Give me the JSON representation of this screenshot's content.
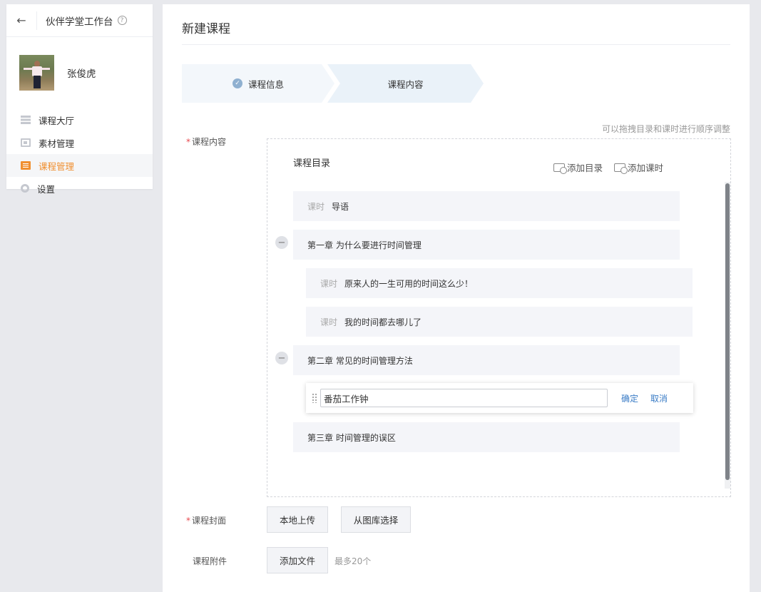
{
  "sidebar": {
    "back_icon": "arrow-left-icon",
    "title": "伙伴学堂工作台",
    "help_icon": "question-circle-icon",
    "user_name": "张俊虎",
    "items": [
      {
        "label": "课程大厅",
        "icon": "list-icon"
      },
      {
        "label": "素材管理",
        "icon": "media-icon"
      },
      {
        "label": "课程管理",
        "icon": "course-icon",
        "active": true
      },
      {
        "label": "设置",
        "icon": "gear-icon"
      }
    ],
    "active_color": "#f08f30"
  },
  "main": {
    "page_title": "新建课程",
    "steps": [
      {
        "label": "课程信息",
        "done": true
      },
      {
        "label": "课程内容",
        "done": false
      }
    ],
    "hint": "可以拖拽目录和课时进行顺序调整",
    "content_label": "课程内容",
    "catalog": {
      "title": "课程目录",
      "add_dir_label": "添加目录",
      "add_lesson_label": "添加课时",
      "lesson_tag": "课时",
      "rows": [
        {
          "type": "lesson",
          "text": "导语"
        },
        {
          "type": "chapter",
          "text": "第一章 为什么要进行时间管理"
        },
        {
          "type": "lesson",
          "text": "原来人的一生可用的时间这么少！"
        },
        {
          "type": "lesson",
          "text": "我的时间都去哪儿了"
        },
        {
          "type": "chapter",
          "text": "第二章 常见的时间管理方法"
        },
        {
          "type": "chapter",
          "text": "第三章 时间管理的误区"
        }
      ],
      "edit": {
        "value": "番茄工作钟",
        "confirm_label": "确定",
        "cancel_label": "取消"
      }
    },
    "cover_label": "课程封面",
    "cover_buttons": {
      "local": "本地上传",
      "library": "从图库选择"
    },
    "attach_label": "课程附件",
    "attach_button": "添加文件",
    "attach_note": "最多20个",
    "link_color": "#3a7cc6",
    "required_color": "#e8484e"
  }
}
